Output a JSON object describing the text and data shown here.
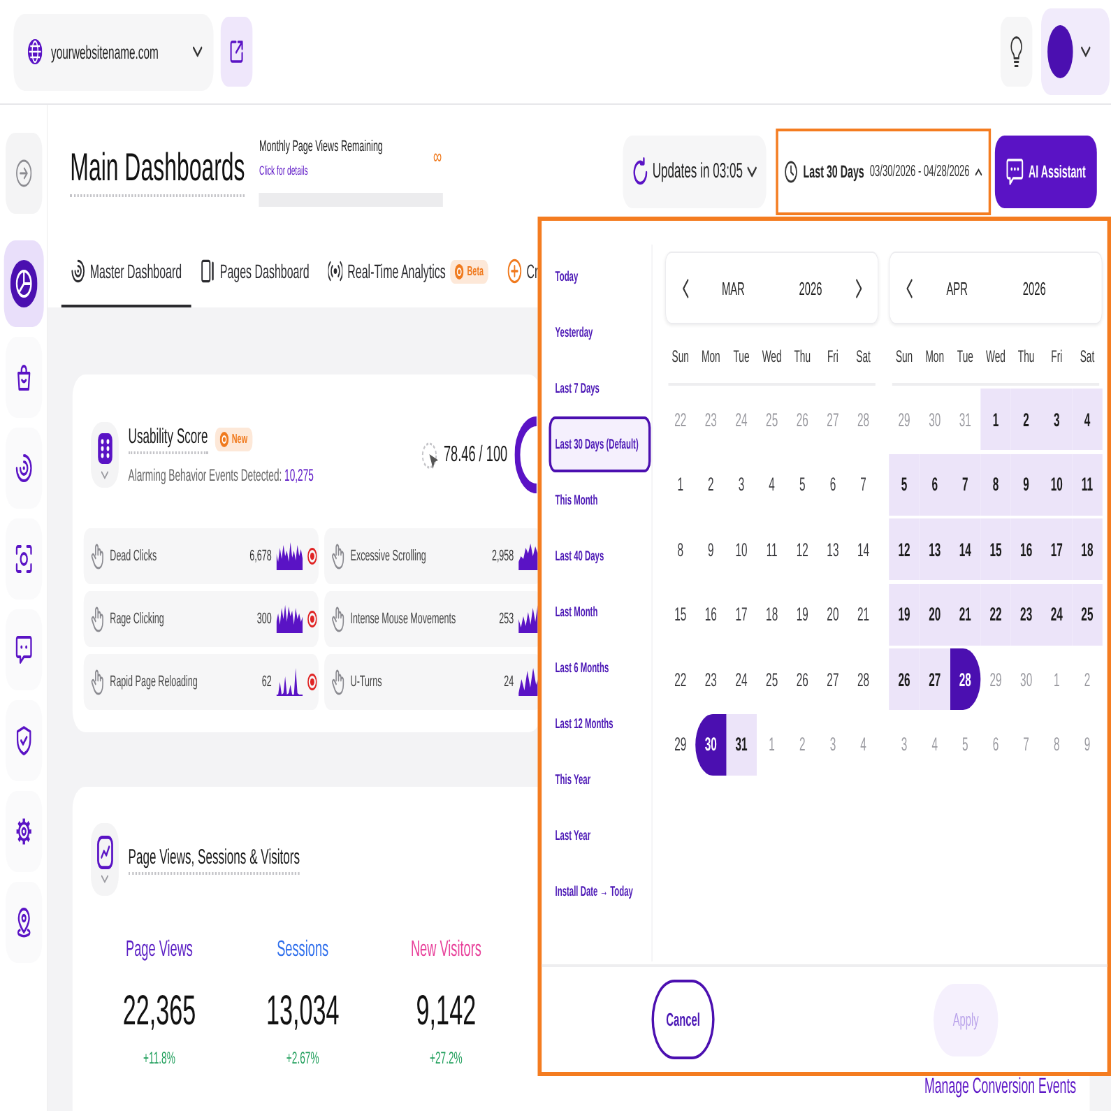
{
  "top_bar": {
    "site": "yourwebsitename.com"
  },
  "sidebar": {
    "items": [
      {
        "selected": true
      },
      {
        "selected": false
      },
      {
        "selected": false
      },
      {
        "selected": false
      },
      {
        "selected": false
      },
      {
        "selected": false
      },
      {
        "selected": false
      },
      {
        "selected": false
      }
    ]
  },
  "header": {
    "title": "Main Dashboards",
    "quota": {
      "label": "Monthly Page Views Remaining",
      "link": "Click for details",
      "value": "∞"
    },
    "updates": {
      "label": "Updates in 03:05"
    },
    "date_range": {
      "label": "Last 30 Days",
      "dates": "03/30/2026 - 04/28/2026",
      "highlighted": true
    },
    "assistant": {
      "label": "AI Assistant"
    }
  },
  "tabs": [
    {
      "label": "Master Dashboard",
      "selected": true
    },
    {
      "label": "Pages Dashboard",
      "selected": false
    },
    {
      "label": "Real-Time Analytics",
      "selected": false,
      "badge": "Beta"
    },
    {
      "label": "Cr",
      "selected": false
    }
  ],
  "usability": {
    "title": "Usability Score",
    "badge": "New",
    "summary_label": "Alarming Behavior Events Detected:",
    "summary_value": "10,275",
    "score": "78.46 / 100",
    "metrics": [
      {
        "name": "Dead Clicks",
        "count": "6,678"
      },
      {
        "name": "Excessive Scrolling",
        "count": "2,958"
      },
      {
        "name": "Rage Clicking",
        "count": "300"
      },
      {
        "name": "Intense Mouse Movements",
        "count": "253"
      },
      {
        "name": "Rapid Page Reloading",
        "count": "62"
      },
      {
        "name": "U-Turns",
        "count": "24"
      }
    ]
  },
  "traffic": {
    "title": "Page Views, Sessions & Visitors",
    "stats": [
      {
        "label": "Page Views",
        "value": "22,365",
        "change": "+11.8%",
        "color": "#5b1fc4"
      },
      {
        "label": "Sessions",
        "value": "13,034",
        "change": "+2.67%",
        "color": "#2f6fec"
      },
      {
        "label": "New Visitors",
        "value": "9,142",
        "change": "+27.2%",
        "color": "#e8409a"
      }
    ],
    "link": "Manage Conversion Events"
  },
  "date_picker": {
    "highlighted": true,
    "presets": [
      {
        "label": "Today",
        "selected": false
      },
      {
        "label": "Yesterday",
        "selected": false
      },
      {
        "label": "Last 7 Days",
        "selected": false
      },
      {
        "label": "Last 30 Days (Default)",
        "selected": true
      },
      {
        "label": "This Month",
        "selected": false
      },
      {
        "label": "Last 40 Days",
        "selected": false
      },
      {
        "label": "Last Month",
        "selected": false
      },
      {
        "label": "Last 6 Months",
        "selected": false
      },
      {
        "label": "Last 12 Months",
        "selected": false
      },
      {
        "label": "This Year",
        "selected": false
      },
      {
        "label": "Last Year",
        "selected": false
      },
      {
        "label": "Install Date → Today",
        "selected": false
      }
    ],
    "months": [
      {
        "month": "MAR",
        "year": "2026",
        "has_prev": true,
        "has_next": true,
        "weekdays": [
          "Sun",
          "Mon",
          "Tue",
          "Wed",
          "Thu",
          "Fri",
          "Sat"
        ],
        "weeks": [
          [
            {
              "d": "22",
              "kind": "muted"
            },
            {
              "d": "23",
              "kind": "muted"
            },
            {
              "d": "24",
              "kind": "muted"
            },
            {
              "d": "25",
              "kind": "muted"
            },
            {
              "d": "26",
              "kind": "muted"
            },
            {
              "d": "27",
              "kind": "muted"
            },
            {
              "d": "28",
              "kind": "muted"
            }
          ],
          [
            {
              "d": "1",
              "kind": "day"
            },
            {
              "d": "2",
              "kind": "day"
            },
            {
              "d": "3",
              "kind": "day"
            },
            {
              "d": "4",
              "kind": "day"
            },
            {
              "d": "5",
              "kind": "day"
            },
            {
              "d": "6",
              "kind": "day"
            },
            {
              "d": "7",
              "kind": "day"
            }
          ],
          [
            {
              "d": "8",
              "kind": "day"
            },
            {
              "d": "9",
              "kind": "day"
            },
            {
              "d": "10",
              "kind": "day"
            },
            {
              "d": "11",
              "kind": "day"
            },
            {
              "d": "12",
              "kind": "day"
            },
            {
              "d": "13",
              "kind": "day"
            },
            {
              "d": "14",
              "kind": "day"
            }
          ],
          [
            {
              "d": "15",
              "kind": "day"
            },
            {
              "d": "16",
              "kind": "day"
            },
            {
              "d": "17",
              "kind": "day"
            },
            {
              "d": "18",
              "kind": "day"
            },
            {
              "d": "19",
              "kind": "day"
            },
            {
              "d": "20",
              "kind": "day"
            },
            {
              "d": "21",
              "kind": "day"
            }
          ],
          [
            {
              "d": "22",
              "kind": "day"
            },
            {
              "d": "23",
              "kind": "day"
            },
            {
              "d": "24",
              "kind": "day"
            },
            {
              "d": "25",
              "kind": "day"
            },
            {
              "d": "26",
              "kind": "day"
            },
            {
              "d": "27",
              "kind": "day"
            },
            {
              "d": "28",
              "kind": "day"
            }
          ],
          [
            {
              "d": "29",
              "kind": "day"
            },
            {
              "d": "30",
              "kind": "start"
            },
            {
              "d": "31",
              "kind": "range"
            },
            {
              "d": "1",
              "kind": "muted"
            },
            {
              "d": "2",
              "kind": "muted"
            },
            {
              "d": "3",
              "kind": "muted"
            },
            {
              "d": "4",
              "kind": "muted"
            }
          ]
        ]
      },
      {
        "month": "APR",
        "year": "2026",
        "has_prev": true,
        "has_next": false,
        "weekdays": [
          "Sun",
          "Mon",
          "Tue",
          "Wed",
          "Thu",
          "Fri",
          "Sat"
        ],
        "weeks": [
          [
            {
              "d": "29",
              "kind": "muted"
            },
            {
              "d": "30",
              "kind": "muted"
            },
            {
              "d": "31",
              "kind": "muted"
            },
            {
              "d": "1",
              "kind": "range"
            },
            {
              "d": "2",
              "kind": "range"
            },
            {
              "d": "3",
              "kind": "range"
            },
            {
              "d": "4",
              "kind": "range"
            }
          ],
          [
            {
              "d": "5",
              "kind": "range"
            },
            {
              "d": "6",
              "kind": "range"
            },
            {
              "d": "7",
              "kind": "range"
            },
            {
              "d": "8",
              "kind": "range"
            },
            {
              "d": "9",
              "kind": "range"
            },
            {
              "d": "10",
              "kind": "range"
            },
            {
              "d": "11",
              "kind": "range"
            }
          ],
          [
            {
              "d": "12",
              "kind": "range"
            },
            {
              "d": "13",
              "kind": "range"
            },
            {
              "d": "14",
              "kind": "range"
            },
            {
              "d": "15",
              "kind": "range"
            },
            {
              "d": "16",
              "kind": "range"
            },
            {
              "d": "17",
              "kind": "range"
            },
            {
              "d": "18",
              "kind": "range"
            }
          ],
          [
            {
              "d": "19",
              "kind": "range"
            },
            {
              "d": "20",
              "kind": "range"
            },
            {
              "d": "21",
              "kind": "range"
            },
            {
              "d": "22",
              "kind": "range"
            },
            {
              "d": "23",
              "kind": "range"
            },
            {
              "d": "24",
              "kind": "range"
            },
            {
              "d": "25",
              "kind": "range"
            }
          ],
          [
            {
              "d": "26",
              "kind": "range"
            },
            {
              "d": "27",
              "kind": "range"
            },
            {
              "d": "28",
              "kind": "end"
            },
            {
              "d": "29",
              "kind": "muted"
            },
            {
              "d": "30",
              "kind": "muted"
            },
            {
              "d": "1",
              "kind": "muted"
            },
            {
              "d": "2",
              "kind": "muted"
            }
          ],
          [
            {
              "d": "3",
              "kind": "muted"
            },
            {
              "d": "4",
              "kind": "muted"
            },
            {
              "d": "5",
              "kind": "muted"
            },
            {
              "d": "6",
              "kind": "muted"
            },
            {
              "d": "7",
              "kind": "muted"
            },
            {
              "d": "8",
              "kind": "muted"
            },
            {
              "d": "9",
              "kind": "muted"
            }
          ]
        ]
      }
    ],
    "buttons": [
      {
        "label": "Cancel",
        "kind": "secondary",
        "disabled": false
      },
      {
        "label": "Apply",
        "kind": "primary",
        "disabled": true
      }
    ]
  }
}
